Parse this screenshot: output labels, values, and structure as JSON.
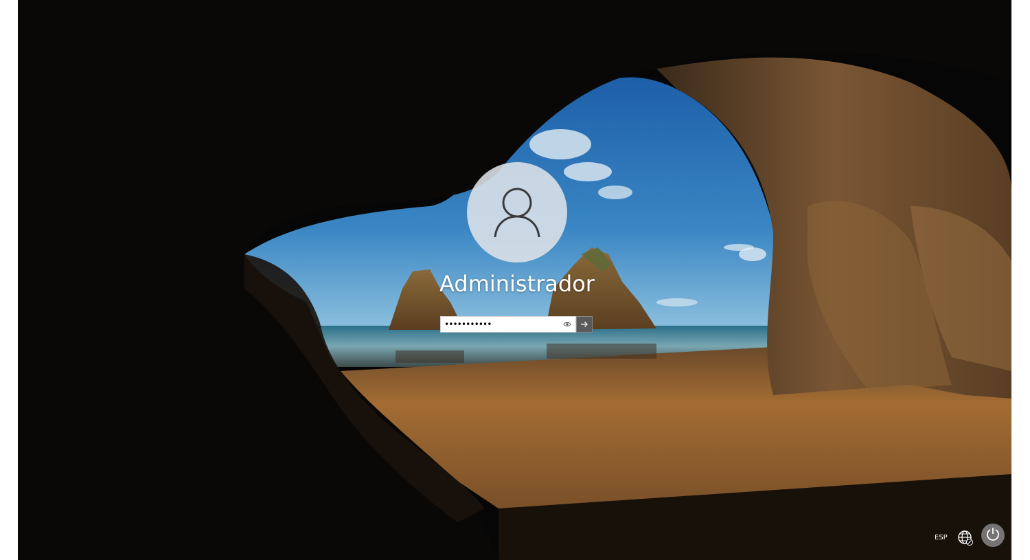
{
  "window": {
    "background_colors": {
      "frame": "#050505",
      "sky": "#2c6fb0",
      "sand": "#a56d2f",
      "rock": "#6b4a2a"
    }
  },
  "login": {
    "avatar_icon": "user-icon",
    "username": "Administrador",
    "password_value": "•••••••••••",
    "reveal_icon": "eye-icon",
    "submit_icon": "arrow-right-icon"
  },
  "tray": {
    "language": "ESP",
    "network_icon": "globe-network-icon",
    "power_icon": "power-icon"
  }
}
